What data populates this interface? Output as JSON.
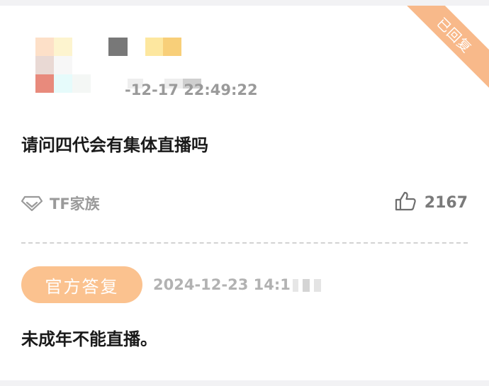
{
  "post": {
    "status_ribbon": "已回复",
    "date_visible": "-12-17 22:49:22",
    "question": "请问四代会有集体直播吗",
    "tag_label": "TF家族",
    "like_count": "2167"
  },
  "reply": {
    "badge_label": "官方答复",
    "date_visible": "2024-12-23 14:1",
    "answer": "未成年不能直播。"
  },
  "colors": {
    "accent_orange": "#fbc28f",
    "ribbon_orange": "#f8b98a",
    "text_primary": "#1a1a1a",
    "text_muted": "#9a9a9a"
  },
  "icons": {
    "tag": "diamond-tag-icon",
    "like": "thumbs-up-icon"
  }
}
